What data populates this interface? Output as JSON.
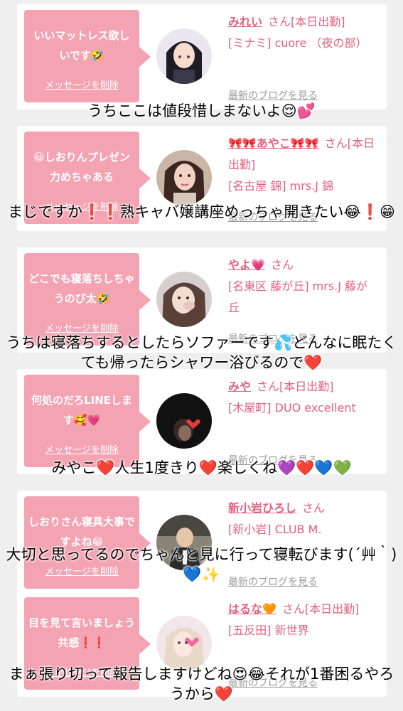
{
  "cards": [
    {
      "bubble": "いいマットレス欲しいです🤣",
      "delete": "メッセージを削除",
      "name": "みれい",
      "suffix": "さん[本日出勤]",
      "shop": "[ミナミ] cuore （夜の部）",
      "blog": "最新のブログを見る"
    },
    {
      "bubble": "😃しおりんプレゼン力めちゃある",
      "delete": "メッセージを削除",
      "name": "🎀🎀あやこ🎀🎀",
      "suffix": "さん[本日出勤]",
      "shop": "[名古屋 錦] mrs.J 錦",
      "blog": "最新のブログを見る"
    },
    {
      "bubble": "どこでも寝落ちしちゃうのび太🤣",
      "delete": "メッセージを削除",
      "name": "やよ💗",
      "suffix": "さん",
      "shop": "[名東区 藤が丘] mrs.J 藤が丘",
      "blog": "最新のブログを見る"
    },
    {
      "bubble": "何処のだろLINEします🥰💗",
      "delete": "メッセージを削除",
      "name": "みや",
      "suffix": "さん[本日出勤]",
      "shop": "[木屋町] DUO excellent",
      "blog": "最新のブログを見る"
    },
    {
      "bubble": "しおりさん寝具大事ですよね😁",
      "delete": "メッセージを削除",
      "name": "新小岩ひろし",
      "suffix": "さん",
      "shop": "[新小岩] CLUB M.",
      "blog": "最新のブログを見る"
    },
    {
      "bubble": "目を見て言いましょう共感❗️❗️",
      "delete": "メッセージを削除",
      "name": "はるな🧡",
      "suffix": "さん[本日出勤]",
      "shop": "[五反田] 新世界",
      "blog": "最新のブログを見る"
    }
  ],
  "captions": [
    "うちここは値段惜しまないよ😌💕",
    "まじですか❗️❗️熟キャバ嬢講座めっちゃ開きたい😂❗️😁",
    "うちは寝落ちするとしたらソファーです💦どんなに眠たくても帰ったらシャワー浴びるので❤️",
    "みやこ❤️人生1度きり❤️楽しくね💜❤️💙💚",
    "大切と思ってるのでちゃんと見に行って寝転びます(´艸｀)💙✨",
    "まぁ張り切って報告しますけどね😍😂それが1番困るやろうから❤️"
  ]
}
